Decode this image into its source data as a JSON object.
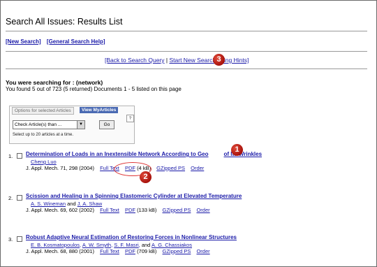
{
  "page": {
    "title": "Search All Issues: Results List",
    "top_links": [
      "[New Search]",
      "[General Search Help]"
    ],
    "nav": {
      "back": "[Back to Search Query",
      "sep": "|",
      "start": "Start New Search",
      "hints": "rching Hints]"
    },
    "searching_for": "You were searching for : (network)",
    "found": "You found 5 out of 723 (5 returned)   Documents 1 - 5 listed on this page"
  },
  "options": {
    "tab_label": "Options for selected Articles",
    "view_tab": "View MyArticles",
    "help": "?",
    "select_value": "Check Article(s) than ...",
    "go_label": "Go",
    "note": "Select up to 20 articles at a time."
  },
  "results": [
    {
      "num": "1.",
      "title": "Determination of Loads in an Inextensible Network According to Geo",
      "title_tail": "of Its Wrinkles",
      "authors": [
        "Cheng Luo"
      ],
      "author_joiner": "",
      "cite": "J. Appl. Mech. 71, 298 (2004)",
      "links": [
        "Full Text",
        "PDF",
        "(4 kB)",
        "GZipped PS",
        "Order"
      ]
    },
    {
      "num": "2.",
      "title": "Scission and Healing in a Spinning Elastomeric Cylinder at Elevated Temperature",
      "title_tail": "",
      "authors": [
        "A. S. Wineman",
        "J. A. Shaw"
      ],
      "author_joiner": "and",
      "cite": "J. Appl. Mech. 69, 602 (2002)",
      "links": [
        "Full Text",
        "PDF",
        "(133 kB)",
        "GZipped PS",
        "Order"
      ]
    },
    {
      "num": "3.",
      "title": "Robust Adaptive Neural Estimation of Restoring Forces in Nonlinear Structures",
      "title_tail": "",
      "authors": [
        "E. B. Kosmatopoulos",
        "A. W. Smyth",
        "S. F. Masri",
        "A. G. Chassiakos"
      ],
      "author_joiner": "and",
      "cite": "J. Appl. Mech. 68, 880 (2001)",
      "links": [
        "Full Text",
        "PDF",
        "(709 kB)",
        "GZipped PS",
        "Order"
      ]
    }
  ],
  "badges": [
    "1",
    "2",
    "3"
  ],
  "colors": {
    "link": "#1a1aa8",
    "badge": "#c0201a",
    "tab": "#4a6ab3"
  }
}
